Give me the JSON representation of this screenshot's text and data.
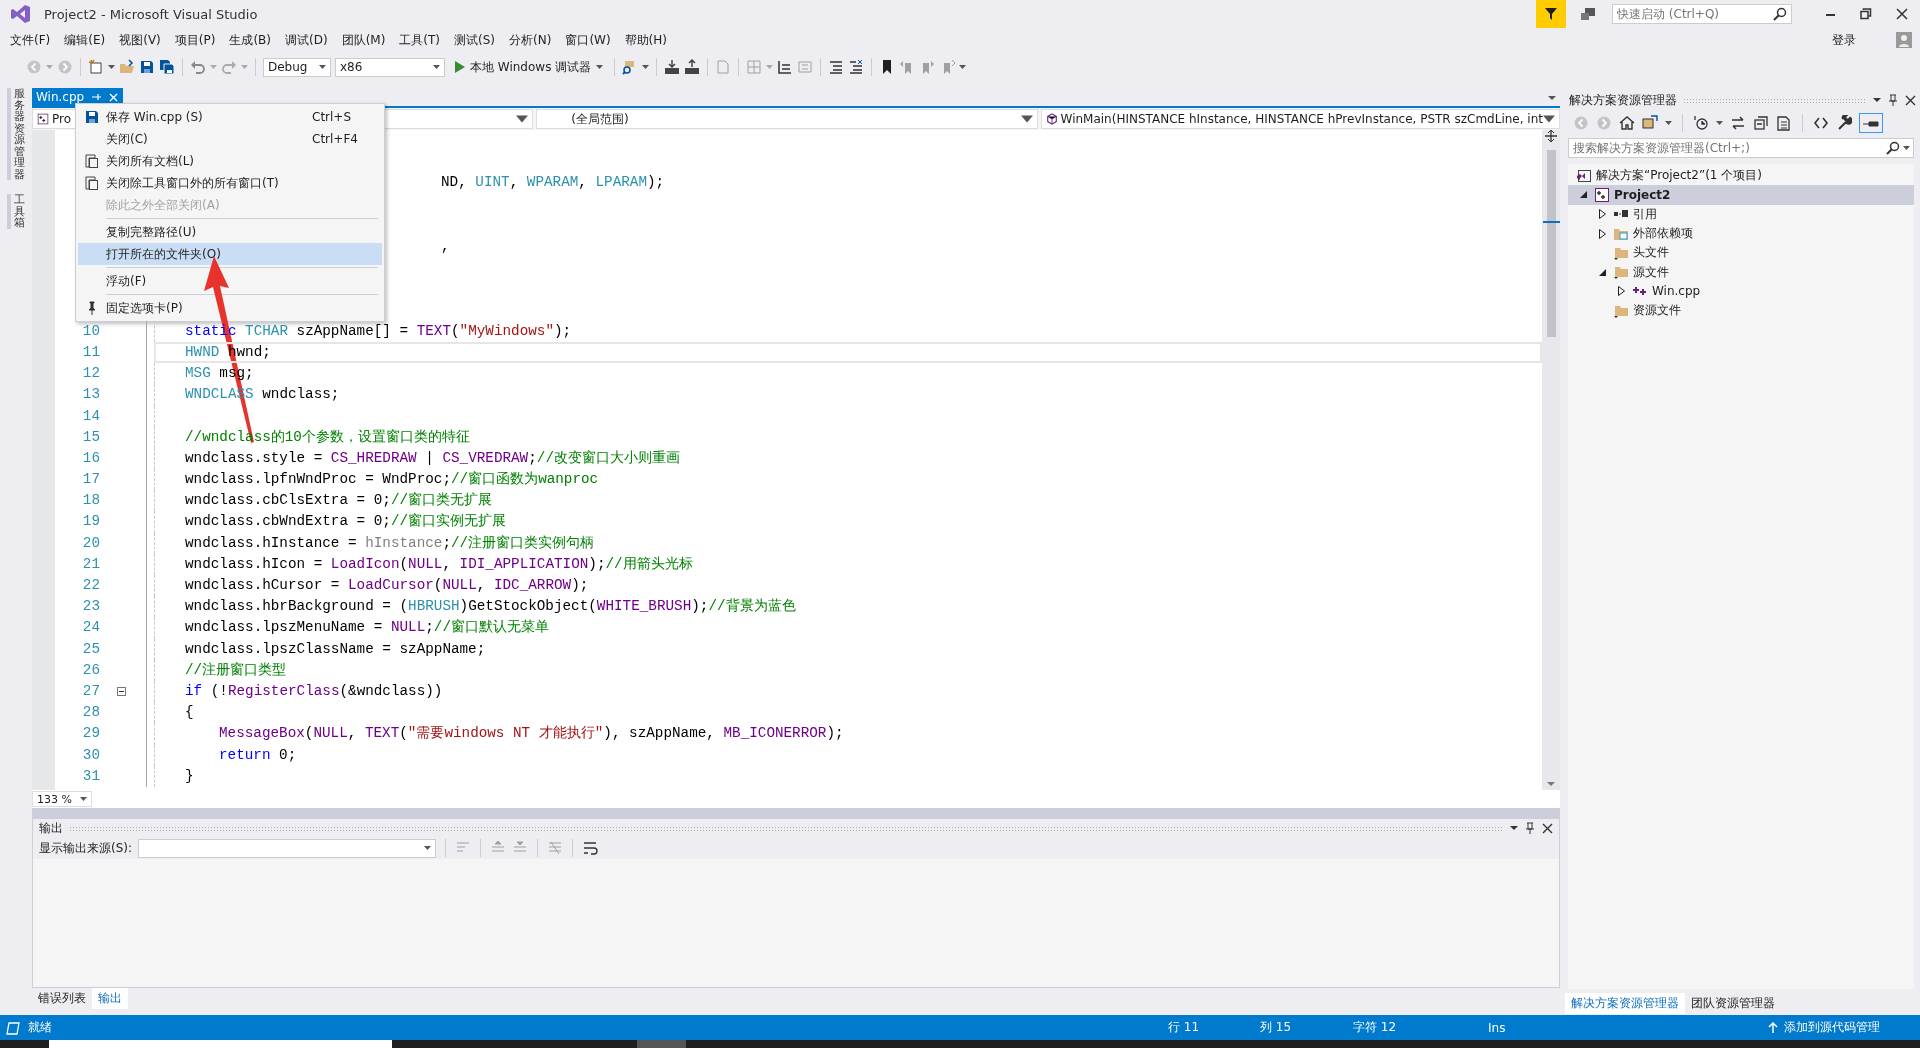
{
  "window": {
    "title": "Project2 - Microsoft Visual Studio"
  },
  "quick_launch": {
    "placeholder": "快速启动 (Ctrl+Q)"
  },
  "account": {
    "sign_in": "登录"
  },
  "menu": [
    "文件(F)",
    "编辑(E)",
    "视图(V)",
    "项目(P)",
    "生成(B)",
    "调试(D)",
    "团队(M)",
    "工具(T)",
    "测试(S)",
    "分析(N)",
    "窗口(W)",
    "帮助(H)"
  ],
  "toolbar": {
    "configuration": "Debug",
    "platform": "x86",
    "run": "本地 Windows 调试器"
  },
  "side_tabs": [
    "服务器资源管理器",
    "工具箱"
  ],
  "document_tabs": [
    {
      "label": "Win.cpp",
      "selected": true
    }
  ],
  "nav_bar": {
    "project": "Pro",
    "scope": "(全局范围)",
    "member": "WinMain(HINSTANCE hInstance, HINSTANCE hPrevInstance, PSTR szCmdLine, int"
  },
  "context_menu": [
    {
      "kind": "item",
      "label": "保存 Win.cpp (S)",
      "shortcut": "Ctrl+S",
      "disabled": false,
      "selected": false
    },
    {
      "kind": "item",
      "label": "关闭(C)",
      "shortcut": "Ctrl+F4",
      "disabled": false,
      "selected": false
    },
    {
      "kind": "item",
      "label": "关闭所有文档(L)",
      "disabled": false,
      "selected": false
    },
    {
      "kind": "item",
      "label": "关闭除工具窗口外的所有窗口(T)",
      "disabled": false,
      "selected": false
    },
    {
      "kind": "item",
      "label": "除此之外全部关闭(A)",
      "disabled": true,
      "selected": false
    },
    {
      "kind": "separator"
    },
    {
      "kind": "item",
      "label": "复制完整路径(U)",
      "disabled": false,
      "selected": false
    },
    {
      "kind": "item",
      "label": "打开所在的文件夹(O)",
      "disabled": false,
      "selected": true
    },
    {
      "kind": "separator"
    },
    {
      "kind": "item",
      "label": "浮动(F)",
      "disabled": false,
      "selected": false
    },
    {
      "kind": "separator"
    },
    {
      "kind": "item",
      "label": "固定选项卡(P)",
      "disabled": false,
      "selected": false
    }
  ],
  "editor": {
    "zoom": "133 %",
    "hidden_line_fragments": [
      {
        "segments": [
          {
            "kind": "plain",
            "text": "ND, "
          },
          {
            "kind": "type",
            "text": "UINT"
          },
          {
            "kind": "plain",
            "text": ", "
          },
          {
            "kind": "type",
            "text": "WPARAM"
          },
          {
            "kind": "plain",
            "text": ", "
          },
          {
            "kind": "type",
            "text": "LPARAM"
          },
          {
            "kind": "plain",
            "text": ");"
          }
        ]
      },
      {
        "segments": [
          {
            "kind": "plain",
            "text": ","
          }
        ]
      }
    ],
    "lines": [
      {
        "number": "10",
        "current": false,
        "segments": [
          {
            "kind": "kw",
            "text": "static "
          },
          {
            "kind": "type",
            "text": "TCHAR"
          },
          {
            "kind": "plain",
            "text": " szAppName[] = "
          },
          {
            "kind": "macro",
            "text": "TEXT"
          },
          {
            "kind": "plain",
            "text": "("
          },
          {
            "kind": "str",
            "text": "\"MyWindows\""
          },
          {
            "kind": "plain",
            "text": ");"
          }
        ]
      },
      {
        "number": "11",
        "current": true,
        "segments": [
          {
            "kind": "type",
            "text": "HWND"
          },
          {
            "kind": "plain",
            "text": " hwnd;"
          }
        ]
      },
      {
        "number": "12",
        "current": false,
        "segments": [
          {
            "kind": "type",
            "text": "MSG"
          },
          {
            "kind": "plain",
            "text": " msg;"
          }
        ]
      },
      {
        "number": "13",
        "current": false,
        "segments": [
          {
            "kind": "type",
            "text": "WNDCLASS"
          },
          {
            "kind": "plain",
            "text": " wndclass;"
          }
        ]
      },
      {
        "number": "14",
        "current": false
      },
      {
        "number": "15",
        "current": false,
        "segments": [
          {
            "kind": "cm",
            "text": "//wndclass的10个参数，设置窗口类的特征"
          }
        ]
      },
      {
        "number": "16",
        "current": false,
        "segments": [
          {
            "kind": "plain",
            "text": "wndclass.style = "
          },
          {
            "kind": "macro",
            "text": "CS_HREDRAW"
          },
          {
            "kind": "plain",
            "text": " | "
          },
          {
            "kind": "macro",
            "text": "CS_VREDRAW"
          },
          {
            "kind": "plain",
            "text": ";"
          },
          {
            "kind": "cm",
            "text": "//改变窗口大小则重画"
          }
        ]
      },
      {
        "number": "17",
        "current": false,
        "segments": [
          {
            "kind": "plain",
            "text": "wndclass.lpfnWndProc = WndProc;"
          },
          {
            "kind": "cm",
            "text": "//窗口函数为wanproc"
          }
        ]
      },
      {
        "number": "18",
        "current": false,
        "segments": [
          {
            "kind": "plain",
            "text": "wndclass.cbClsExtra = 0;"
          },
          {
            "kind": "cm",
            "text": "//窗口类无扩展"
          }
        ]
      },
      {
        "number": "19",
        "current": false,
        "segments": [
          {
            "kind": "plain",
            "text": "wndclass.cbWndExtra = 0;"
          },
          {
            "kind": "cm",
            "text": "//窗口实例无扩展"
          }
        ]
      },
      {
        "number": "20",
        "current": false,
        "segments": [
          {
            "kind": "plain",
            "text": "wndclass.hInstance = "
          },
          {
            "kind": "param",
            "text": "hInstance"
          },
          {
            "kind": "plain",
            "text": ";"
          },
          {
            "kind": "cm",
            "text": "//注册窗口类实例句柄"
          }
        ]
      },
      {
        "number": "21",
        "current": false,
        "segments": [
          {
            "kind": "plain",
            "text": "wndclass.hIcon = "
          },
          {
            "kind": "macro",
            "text": "LoadIcon"
          },
          {
            "kind": "plain",
            "text": "("
          },
          {
            "kind": "macro",
            "text": "NULL"
          },
          {
            "kind": "plain",
            "text": ", "
          },
          {
            "kind": "macro",
            "text": "IDI_APPLICATION"
          },
          {
            "kind": "plain",
            "text": ");"
          },
          {
            "kind": "cm",
            "text": "//用箭头光标"
          }
        ]
      },
      {
        "number": "22",
        "current": false,
        "segments": [
          {
            "kind": "plain",
            "text": "wndclass.hCursor = "
          },
          {
            "kind": "macro",
            "text": "LoadCursor"
          },
          {
            "kind": "plain",
            "text": "("
          },
          {
            "kind": "macro",
            "text": "NULL"
          },
          {
            "kind": "plain",
            "text": ", "
          },
          {
            "kind": "macro",
            "text": "IDC_ARROW"
          },
          {
            "kind": "plain",
            "text": ");"
          }
        ]
      },
      {
        "number": "23",
        "current": false,
        "segments": [
          {
            "kind": "plain",
            "text": "wndclass.hbrBackground = ("
          },
          {
            "kind": "type",
            "text": "HBRUSH"
          },
          {
            "kind": "plain",
            "text": ")GetStockObject("
          },
          {
            "kind": "macro",
            "text": "WHITE_BRUSH"
          },
          {
            "kind": "plain",
            "text": ");"
          },
          {
            "kind": "cm",
            "text": "//背景为蓝色"
          }
        ]
      },
      {
        "number": "24",
        "current": false,
        "segments": [
          {
            "kind": "plain",
            "text": "wndclass.lpszMenuName = "
          },
          {
            "kind": "macro",
            "text": "NULL"
          },
          {
            "kind": "plain",
            "text": ";"
          },
          {
            "kind": "cm",
            "text": "//窗口默认无菜单"
          }
        ]
      },
      {
        "number": "25",
        "current": false,
        "segments": [
          {
            "kind": "plain",
            "text": "wndclass.lpszClassName = szAppName;"
          }
        ]
      },
      {
        "number": "26",
        "current": false,
        "segments": [
          {
            "kind": "cm",
            "text": "//注册窗口类型"
          }
        ]
      },
      {
        "number": "27",
        "current": false,
        "expanded": true,
        "segments": [
          {
            "kind": "kw",
            "text": "if"
          },
          {
            "kind": "plain",
            "text": " (!"
          },
          {
            "kind": "macro",
            "text": "RegisterClass"
          },
          {
            "kind": "plain",
            "text": "(&wndclass))"
          }
        ]
      },
      {
        "number": "28",
        "current": false,
        "segments": [
          {
            "kind": "plain",
            "text": "{"
          }
        ],
        "children": [
          {
            "number": "29",
            "current": false,
            "segments": [
              {
                "kind": "macro",
                "text": "MessageBox"
              },
              {
                "kind": "plain",
                "text": "("
              },
              {
                "kind": "macro",
                "text": "NULL"
              },
              {
                "kind": "plain",
                "text": ", "
              },
              {
                "kind": "macro",
                "text": "TEXT"
              },
              {
                "kind": "plain",
                "text": "("
              },
              {
                "kind": "str",
                "text": "\"需要windows NT 才能执行\""
              },
              {
                "kind": "plain",
                "text": "), szAppName, "
              },
              {
                "kind": "macro",
                "text": "MB_ICONERROR"
              },
              {
                "kind": "plain",
                "text": ");"
              }
            ]
          },
          {
            "number": "30",
            "current": false,
            "segments": [
              {
                "kind": "kw",
                "text": "return"
              },
              {
                "kind": "plain",
                "text": " 0;"
              }
            ]
          }
        ]
      },
      {
        "number": "31",
        "current": false,
        "segments": [
          {
            "kind": "plain",
            "text": "}"
          }
        ]
      }
    ]
  },
  "output": {
    "title": "输出",
    "source_label": "显示输出来源(S):"
  },
  "bottom_tabs": [
    {
      "label": "错误列表",
      "selected": false
    },
    {
      "label": "输出",
      "selected": true
    }
  ],
  "solution_explorer": {
    "title": "解决方案资源管理器",
    "search_placeholder": "搜索解决方案资源管理器(Ctrl+;)",
    "tree": [
      {
        "kind": "solution",
        "label": "解决方案“Project2”(1 个项目)",
        "selected": false
      },
      {
        "kind": "project",
        "label": "Project2",
        "selected": true,
        "expanded": true,
        "children": [
          {
            "kind": "references",
            "label": "引用",
            "selected": false,
            "expanded": false
          },
          {
            "kind": "external",
            "label": "外部依赖项",
            "selected": false,
            "expanded": false
          },
          {
            "kind": "filter",
            "label": "头文件",
            "selected": false
          },
          {
            "kind": "filter",
            "label": "源文件",
            "selected": false,
            "expanded": true,
            "children": [
              {
                "kind": "cpp",
                "label": "Win.cpp",
                "selected": false,
                "expanded": false
              }
            ]
          },
          {
            "kind": "filter",
            "label": "资源文件",
            "selected": false
          }
        ]
      }
    ],
    "tabs": [
      {
        "label": "解决方案资源管理器",
        "selected": true
      },
      {
        "label": "团队资源管理器",
        "selected": false
      }
    ]
  },
  "status_bar": {
    "state": "就绪",
    "line": "行 11",
    "column": "列 15",
    "char": "字符 12",
    "mode": "Ins",
    "source_control": "添加到源代码管理"
  }
}
